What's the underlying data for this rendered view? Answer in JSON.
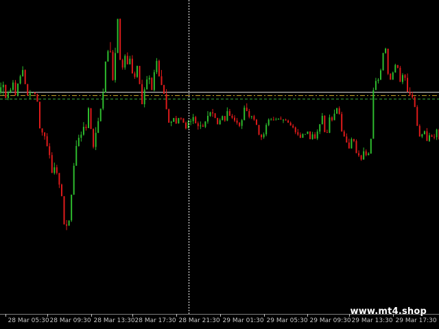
{
  "watermark": "www.mt4.shop",
  "colors": {
    "background": "#000000",
    "bull": "#2ebd2e",
    "bear": "#e01b1b",
    "bid_line": "#d9d9d9",
    "level_line_1": "#c8a428",
    "level_line_2": "#3ea83e",
    "crosshair": "#ffffff",
    "axis_text": "#c8c8c8"
  },
  "chart_data": {
    "type": "candlestick",
    "x_axis": {
      "tick_labels": [
        "28 Mar 05:30",
        "28 Mar 09:30",
        "28 Mar 13:30",
        "28 Mar 17:30",
        "28 Mar 21:30",
        "29 Mar 01:30",
        "29 Mar 05:30",
        "29 Mar 09:30",
        "29 Mar 13:30",
        "29 Mar 17:30"
      ],
      "tick_indices": [
        2,
        19,
        37,
        54,
        72,
        90,
        108,
        126,
        143,
        161
      ]
    },
    "ylim": [
      0,
      100
    ],
    "horizontal_levels": [
      {
        "value": 70.7,
        "style": "solid"
      },
      {
        "value": 69.6,
        "style": "dashdot"
      },
      {
        "value": 68.5,
        "style": "dashed"
      }
    ],
    "crosshair_index": 77,
    "candles": [
      [
        70.6,
        72.2,
        69.9,
        73.7,
        69.1
      ],
      [
        72.2,
        73,
        69.6,
        74,
        68.8
      ],
      [
        73,
        68.8,
        68.8,
        73,
        67.2
      ],
      [
        68.8,
        70.7,
        68.1,
        71.1,
        67.5
      ],
      [
        70.7,
        71.4,
        70.3,
        72,
        69.9
      ],
      [
        71.4,
        73.7,
        71,
        74.5,
        70.6
      ],
      [
        73.7,
        69.6,
        69.6,
        74.5,
        68.8
      ],
      [
        69.6,
        73.4,
        69.3,
        73.4,
        68.5
      ],
      [
        73.4,
        75.7,
        73.1,
        76.2,
        72.6
      ],
      [
        75.7,
        77.7,
        75.6,
        78.9,
        74.8
      ],
      [
        77.7,
        73.2,
        73.2,
        77.9,
        72.3
      ],
      [
        73.2,
        69.6,
        69.6,
        73.3,
        69.1
      ],
      [
        69.6,
        70.4,
        68.5,
        71.3,
        67.9
      ],
      [
        70.4,
        70.5,
        70.4,
        70.6,
        70.1
      ],
      [
        70.5,
        70,
        69.9,
        70.7,
        69.1
      ],
      [
        70,
        67.6,
        67.6,
        70.2,
        66.9
      ],
      [
        67.6,
        59.1,
        59.1,
        67.6,
        58.5
      ],
      [
        59.1,
        57.8,
        56.8,
        59.1,
        54.5
      ],
      [
        57.8,
        56.6,
        55.5,
        57.9,
        54.3
      ],
      [
        56.6,
        53.4,
        53.4,
        57.6,
        52.7
      ],
      [
        53.4,
        50.6,
        49.5,
        54.4,
        49
      ],
      [
        50.6,
        44.9,
        44.9,
        51.5,
        44
      ],
      [
        44.9,
        46.7,
        44.4,
        48.2,
        43.6
      ],
      [
        46.7,
        44.9,
        44.4,
        47.5,
        43.8
      ],
      [
        44.9,
        41.2,
        40.1,
        44.9,
        40.6
      ],
      [
        41.2,
        37.5,
        37.5,
        41.5,
        36.4
      ],
      [
        37.5,
        28.5,
        28.5,
        37.5,
        26.4
      ],
      [
        28.5,
        28.1,
        26.7,
        29.9,
        24
      ],
      [
        28.1,
        29.8,
        28.1,
        29.8,
        27.6
      ],
      [
        29.8,
        38,
        29.3,
        38,
        28.8
      ],
      [
        38,
        47.2,
        37.9,
        48.1,
        37.5
      ],
      [
        47.2,
        53.5,
        47.2,
        55.3,
        46.8
      ],
      [
        53.5,
        56.1,
        53.3,
        57.1,
        52.4
      ],
      [
        56.1,
        57.1,
        54.9,
        58.1,
        54.2
      ],
      [
        57.1,
        59.6,
        56.8,
        61.1,
        55.7
      ],
      [
        59.6,
        59.2,
        58.4,
        60.4,
        57.6
      ],
      [
        59.2,
        65.5,
        59.2,
        65.9,
        58.3
      ],
      [
        65.5,
        58.9,
        58.9,
        65.6,
        57.8
      ],
      [
        58.9,
        53.2,
        52.7,
        59.1,
        52.7
      ],
      [
        53.2,
        57.7,
        52.2,
        59.5,
        52
      ],
      [
        57.7,
        61.4,
        57.6,
        62.5,
        57
      ],
      [
        61.4,
        65.4,
        61.3,
        65.4,
        60.9
      ],
      [
        65.4,
        70.6,
        64.9,
        71.8,
        64.9
      ],
      [
        70.6,
        80.4,
        70.5,
        80.4,
        69.3
      ],
      [
        80.4,
        83.7,
        80.4,
        84.1,
        79.1
      ],
      [
        83.7,
        83.5,
        83.2,
        86.6,
        81.9
      ],
      [
        83.5,
        74.5,
        74.3,
        84.1,
        74.2
      ],
      [
        74.5,
        83.1,
        73.7,
        84.8,
        72.3
      ],
      [
        83.1,
        94,
        83.1,
        94,
        82.1
      ],
      [
        94,
        80.9,
        80.9,
        94.1,
        79
      ],
      [
        80.9,
        78.5,
        77.8,
        81.3,
        76.2
      ],
      [
        78.5,
        82.2,
        77.8,
        82.7,
        76.6
      ],
      [
        82.2,
        79.5,
        79.5,
        83.3,
        78.7
      ],
      [
        79.5,
        81.3,
        79.5,
        82.2,
        78.4
      ],
      [
        81.3,
        76.6,
        76.6,
        82.4,
        76.3
      ],
      [
        76.6,
        75.5,
        74.9,
        77.2,
        73.8
      ],
      [
        75.5,
        79,
        75.2,
        79.1,
        74.8
      ],
      [
        79,
        73.2,
        73.2,
        79,
        72.1
      ],
      [
        73.2,
        66.8,
        66.8,
        74.6,
        65.8
      ],
      [
        66.8,
        71.5,
        65.8,
        72.2,
        65.1
      ],
      [
        71.5,
        74.7,
        71.5,
        75.8,
        70.1
      ],
      [
        74.7,
        75.2,
        73.2,
        76,
        73.2
      ],
      [
        75.2,
        71.3,
        71.3,
        75.4,
        70.6
      ],
      [
        71.3,
        77,
        70.9,
        77.8,
        69.8
      ],
      [
        77,
        80.6,
        76.4,
        81.5,
        76.2
      ],
      [
        80.6,
        75.7,
        75.6,
        81,
        75.6
      ],
      [
        75.7,
        72.9,
        72.9,
        77.7,
        71.6
      ],
      [
        72.9,
        70.1,
        70.1,
        73,
        69.2
      ],
      [
        70.1,
        65.2,
        65.2,
        71.6,
        63.9
      ],
      [
        65.2,
        60.9,
        60.9,
        65.4,
        60.5
      ],
      [
        60.9,
        61.2,
        59.8,
        61.5,
        59.7
      ],
      [
        61.2,
        62.4,
        61.2,
        62.4,
        60.9
      ],
      [
        62.4,
        60.7,
        60.5,
        63.1,
        59.6
      ],
      [
        60.7,
        62.4,
        60.6,
        62.4,
        60.3
      ],
      [
        62.4,
        62.3,
        61.7,
        62.6,
        61.3
      ],
      [
        62.3,
        60.9,
        60.9,
        62.3,
        60.2
      ],
      [
        60.9,
        59.1,
        58.8,
        61.3,
        58.3
      ],
      [
        59.1,
        61.3,
        59.1,
        61.8,
        58.3
      ],
      [
        61.3,
        61.4,
        60.1,
        62.2,
        59.9
      ],
      [
        61.4,
        62.7,
        60.5,
        63.7,
        59.6
      ],
      [
        62.7,
        60.7,
        60.7,
        63.1,
        59.5
      ],
      [
        60.7,
        59.8,
        58.7,
        61.3,
        58.5
      ],
      [
        59.8,
        60,
        58.9,
        61.3,
        58.3
      ],
      [
        60,
        59.6,
        59.6,
        60.6,
        58.3
      ],
      [
        59.6,
        61.3,
        59.2,
        61.4,
        59
      ],
      [
        61.3,
        63.1,
        60.6,
        64.6,
        59.9
      ],
      [
        63.1,
        64.2,
        62.8,
        64.4,
        62
      ],
      [
        64.2,
        63.9,
        62.8,
        65.3,
        62.8
      ],
      [
        63.9,
        62.4,
        62.4,
        64,
        61.5
      ],
      [
        62.4,
        60.4,
        60.4,
        62.5,
        60.2
      ],
      [
        60.4,
        61.7,
        60.3,
        62.3,
        60
      ],
      [
        61.7,
        63,
        61.7,
        63.2,
        60.8
      ],
      [
        63,
        61.6,
        61.2,
        63.1,
        60.8
      ],
      [
        61.6,
        64.6,
        61.4,
        65.8,
        61.3
      ],
      [
        64.6,
        63.1,
        63.1,
        65.3,
        62.7
      ],
      [
        63.1,
        62.5,
        62.1,
        63.7,
        61.2
      ],
      [
        62.5,
        61.6,
        61.1,
        63.3,
        61.1
      ],
      [
        61.6,
        60.9,
        60.3,
        62.4,
        60.1
      ],
      [
        60.9,
        59.9,
        59.5,
        61.1,
        58.5
      ],
      [
        59.9,
        61.7,
        58.9,
        62.1,
        58.4
      ],
      [
        61.7,
        65.7,
        61.7,
        66.4,
        61.7
      ],
      [
        65.7,
        64.6,
        64.6,
        67.1,
        64.2
      ],
      [
        64.6,
        62.8,
        62.3,
        65.3,
        61.9
      ],
      [
        62.8,
        63,
        62.1,
        63.1,
        61.6
      ],
      [
        63,
        61.9,
        61.5,
        63.4,
        61.2
      ],
      [
        61.9,
        60.2,
        60.2,
        62.1,
        59.6
      ],
      [
        60.2,
        57.1,
        56.9,
        60.2,
        56.5
      ],
      [
        57.1,
        56.3,
        55.4,
        57.3,
        54.7
      ],
      [
        56.3,
        57.2,
        55.8,
        57.8,
        55.4
      ],
      [
        57.2,
        60.2,
        56.6,
        60.8,
        56.4
      ],
      [
        60.2,
        61.9,
        59.8,
        62.3,
        58.7
      ],
      [
        61.9,
        61.9,
        61.9,
        62.4,
        61.4
      ],
      [
        61.9,
        61.8,
        61.6,
        62.8,
        61.6
      ],
      [
        61.8,
        61.9,
        61.7,
        62.5,
        61.5
      ],
      [
        61.9,
        62.2,
        61.9,
        62.3,
        61.2
      ],
      [
        62.2,
        61.9,
        61.9,
        62.9,
        61.8
      ],
      [
        61.9,
        61.9,
        60.8,
        62,
        60.2
      ],
      [
        61.9,
        61.6,
        61.6,
        62.2,
        61
      ],
      [
        61.6,
        60.9,
        60.9,
        61.9,
        60.7
      ],
      [
        60.9,
        60,
        60,
        61.3,
        59.1
      ],
      [
        60,
        59.4,
        59.1,
        60.5,
        58.8
      ],
      [
        59.4,
        57.9,
        57.3,
        59.7,
        57.3
      ],
      [
        57.9,
        57.1,
        56.7,
        58.9,
        56.4
      ],
      [
        57.1,
        56.1,
        56,
        57.8,
        55.9
      ],
      [
        56.1,
        57.3,
        56.1,
        57.5,
        56.1
      ],
      [
        57.3,
        57.3,
        57.3,
        57.3,
        57.3
      ],
      [
        57.3,
        58.1,
        57.3,
        58.1,
        57.1
      ],
      [
        58.1,
        55.7,
        55.6,
        58.2,
        55.6
      ],
      [
        55.7,
        57.2,
        55.5,
        58,
        55.5
      ],
      [
        57.2,
        55.9,
        55.7,
        57.9,
        55.1
      ],
      [
        55.9,
        58.1,
        55.4,
        58.8,
        55.3
      ],
      [
        58.1,
        60.4,
        57.3,
        60.5,
        57.2
      ],
      [
        60.4,
        63.1,
        60.4,
        64,
        60.3
      ],
      [
        63.1,
        57.9,
        57.9,
        63.3,
        57.1
      ],
      [
        57.9,
        57.7,
        57.7,
        58.7,
        57.1
      ],
      [
        57.7,
        62.6,
        57.6,
        63.5,
        56.8
      ],
      [
        62.6,
        61.7,
        61.3,
        63,
        60.9
      ],
      [
        61.7,
        63.8,
        61.7,
        65.1,
        61.3
      ],
      [
        63.8,
        65.5,
        63.7,
        65.7,
        63.6
      ],
      [
        65.5,
        63.7,
        63.5,
        66.1,
        63.2
      ],
      [
        63.7,
        58.1,
        58.1,
        64.4,
        58.1
      ],
      [
        58.1,
        56.5,
        56.5,
        58.6,
        56.2
      ],
      [
        56.5,
        54.6,
        54.6,
        57.5,
        53.5
      ],
      [
        54.6,
        52.7,
        52.7,
        55.8,
        52
      ],
      [
        52.7,
        55.7,
        52.7,
        56.2,
        51.3
      ],
      [
        55.7,
        55.1,
        54.7,
        55.8,
        54
      ],
      [
        55.1,
        51.2,
        51.2,
        55.6,
        50.3
      ],
      [
        51.2,
        50.5,
        50,
        52.1,
        48.8
      ],
      [
        50.5,
        49.2,
        48.8,
        50.7,
        48.6
      ],
      [
        49.2,
        51.8,
        49.1,
        53,
        49.1
      ],
      [
        51.8,
        50.6,
        50.2,
        52.4,
        49.8
      ],
      [
        50.6,
        51.1,
        50.5,
        51.5,
        49.8
      ],
      [
        51.1,
        55.8,
        51,
        55.8,
        50.5
      ],
      [
        55.8,
        71.3,
        55.8,
        72.1,
        54.7
      ],
      [
        71.3,
        74.2,
        71.3,
        75.2,
        70.4
      ],
      [
        74.2,
        74.6,
        73.4,
        75.1,
        73.1
      ],
      [
        74.6,
        77.6,
        74.5,
        78.1,
        74.1
      ],
      [
        77.6,
        83.1,
        77.5,
        83.2,
        76.8
      ],
      [
        83.1,
        84.5,
        82.9,
        84.8,
        82.2
      ],
      [
        84.5,
        76.5,
        76.1,
        84.5,
        76.1
      ],
      [
        76.5,
        74.6,
        74.6,
        76.7,
        73.4
      ],
      [
        74.6,
        76.9,
        74.6,
        77.2,
        74.3
      ],
      [
        76.9,
        79.3,
        76.9,
        79.7,
        76.7
      ],
      [
        79.3,
        78.4,
        78.2,
        79.3,
        77.9
      ],
      [
        78.4,
        73.9,
        73.9,
        79,
        73.5
      ],
      [
        73.9,
        76.1,
        73.2,
        76.7,
        72.8
      ],
      [
        76.1,
        75.2,
        74.3,
        76.4,
        73.9
      ],
      [
        75.2,
        70.7,
        70.7,
        76.6,
        69.7
      ],
      [
        70.7,
        69.8,
        69.4,
        72.2,
        69.3
      ],
      [
        69.8,
        69,
        68.5,
        70.8,
        68.1
      ],
      [
        69,
        65.9,
        65.9,
        69.3,
        65.5
      ],
      [
        65.9,
        59.9,
        59.9,
        66.5,
        59.6
      ],
      [
        59.9,
        56.5,
        56.5,
        60.4,
        55.7
      ],
      [
        56.5,
        57.2,
        56,
        57.4,
        55.5
      ],
      [
        57.2,
        58.2,
        57.2,
        58.4,
        56.3
      ],
      [
        58.2,
        55.1,
        55.1,
        59.2,
        54.8
      ],
      [
        55.1,
        56.9,
        54.8,
        57.7,
        54.8
      ],
      [
        56.9,
        56.4,
        56.4,
        57.2,
        55.6
      ],
      [
        56.4,
        56.3,
        55.6,
        57.3,
        55.3
      ],
      [
        56.3,
        58.7,
        55.4,
        59,
        55.3
      ],
      [
        58.7,
        55.6,
        55.6,
        59,
        54.6
      ],
      [
        55.6,
        56.5,
        55.2,
        57.3,
        54.9
      ],
      [
        56.5,
        62.3,
        56.3,
        63.3,
        56.3
      ]
    ]
  }
}
